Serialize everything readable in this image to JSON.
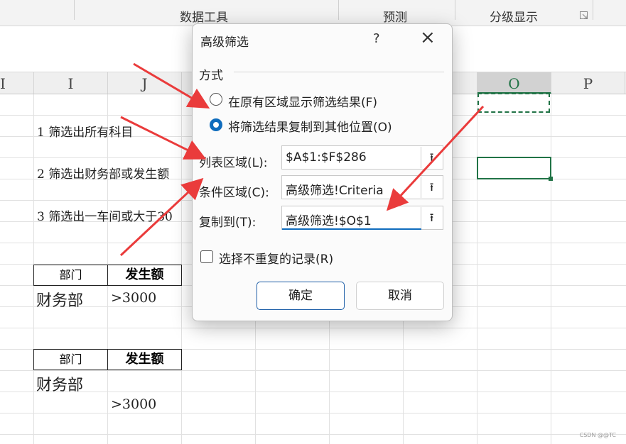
{
  "ribbon": {
    "group1": "数据工具",
    "group2": "预测",
    "group3": "分级显示"
  },
  "columns": [
    "I",
    "J",
    "O",
    "P"
  ],
  "partial_column": "I",
  "sheet": {
    "notes": [
      "1  筛选出所有科目",
      "2  筛选出财务部或发生额",
      "3  筛选出一车间或大于30"
    ],
    "table1": {
      "header_dept": "部门",
      "header_amount": "发生额",
      "dept": "财务部",
      "amount": ">3000"
    },
    "table2": {
      "header_dept": "部门",
      "header_amount": "发生额",
      "dept": "财务部",
      "amount": ">3000"
    }
  },
  "dialog": {
    "title": "高级筛选",
    "help": "?",
    "close": "×",
    "group_label": "方式",
    "option1": "在原有区域显示筛选结果(F)",
    "option2": "将筛选结果复制到其他位置(O)",
    "selected_option": "option2",
    "list_range_label": "列表区域(L):",
    "list_range_value": "$A$1:$F$286",
    "criteria_range_label": "条件区域(C):",
    "criteria_range_value": "高级筛选!Criteria",
    "copy_to_label": "复制到(T):",
    "copy_to_value": "高级筛选!$O$1",
    "unique_label": "选择不重复的记录(R)",
    "unique_checked": false,
    "ok": "确定",
    "cancel": "取消"
  },
  "watermark": "CSDN @@TC",
  "colors": {
    "accent": "#0f6cbd",
    "excel_green": "#217346",
    "arrow": "#ea3b3b"
  }
}
